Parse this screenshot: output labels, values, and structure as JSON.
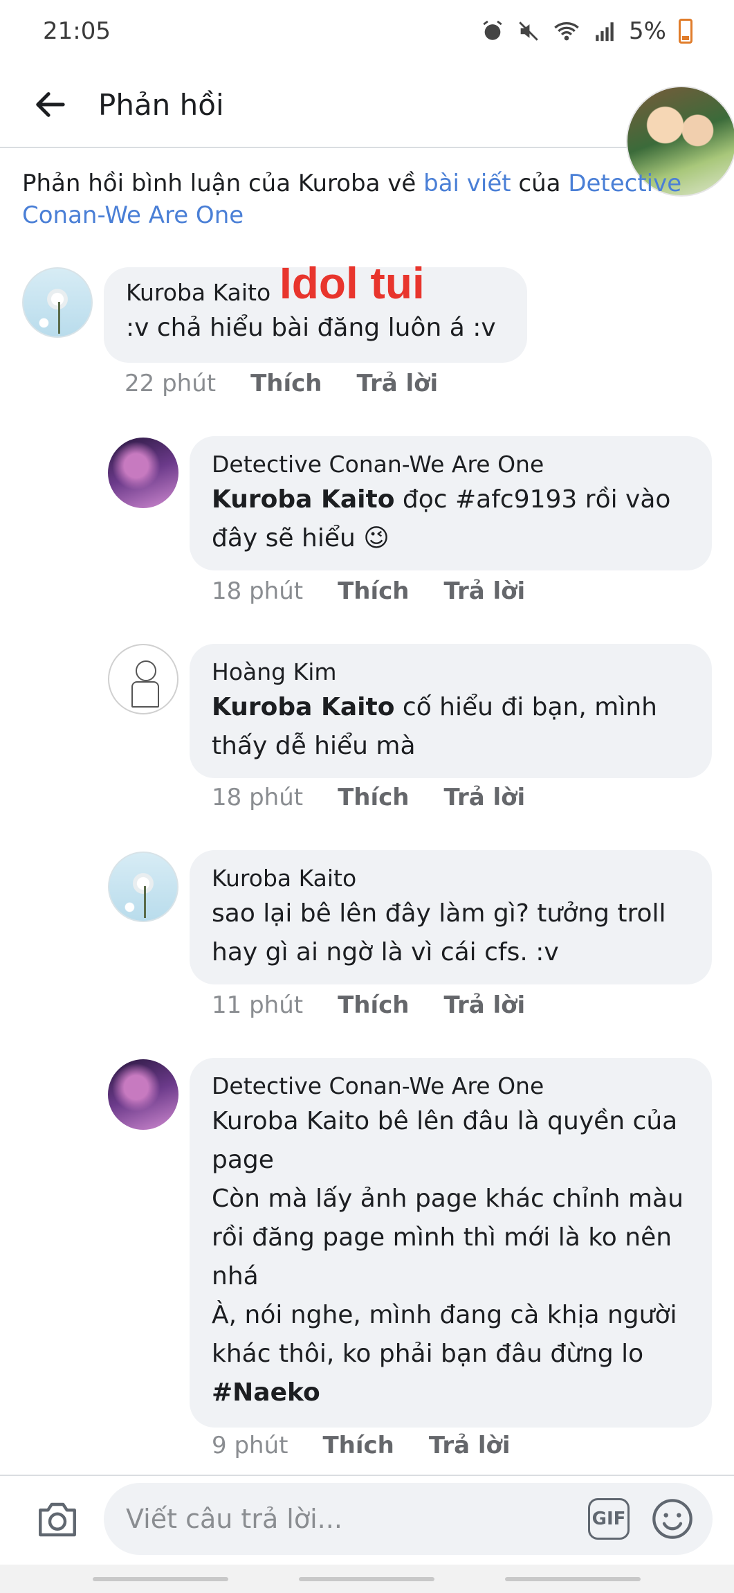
{
  "status_bar": {
    "time": "21:05",
    "battery": "5%",
    "icons": [
      "alarm-icon",
      "mute-icon",
      "wifi-icon",
      "signal-icon",
      "battery-icon"
    ]
  },
  "header": {
    "title": "Phản hồi",
    "back_icon": "back-arrow-icon"
  },
  "context": {
    "prefix": "Phản hồi bình luận của Kuroba về ",
    "post_link": "bài viết",
    "middle": " của ",
    "page_link": "Detective Conan-We Are One"
  },
  "overlay_text": "Idol tui",
  "comments": [
    {
      "author": "Kuroba Kaito",
      "text": ":v chả hiểu bài đăng luôn á :v",
      "time": "22 phút",
      "like": "Thích",
      "reply": "Trả lời"
    },
    {
      "author": "Detective Conan-We Are One",
      "tag": "Kuroba Kaito",
      "text": " đọc #afc9193 rồi vào đây sẽ hiểu 😉",
      "time": "18 phút",
      "like": "Thích",
      "reply": "Trả lời"
    },
    {
      "author": "Hoàng Kim",
      "tag": "Kuroba Kaito",
      "text": " cố hiểu đi bạn, mình thấy dễ hiểu mà",
      "time": "18 phút",
      "like": "Thích",
      "reply": "Trả lời"
    },
    {
      "author": "Kuroba Kaito",
      "text": "sao lại bê lên đây làm gì? tưởng troll hay gì ai ngờ là vì cái cfs. :v",
      "time": "11 phút",
      "like": "Thích",
      "reply": "Trả lời"
    },
    {
      "author": "Detective Conan-We Are One",
      "lines": [
        "Kuroba Kaito bê lên đâu là quyền của page",
        "Còn mà lấy ảnh page khác chỉnh màu rồi đăng page mình thì mới là ko nên nhá",
        "À, nói nghe, mình đang cà khịa người khác thôi, ko phải bạn đâu đừng lo"
      ],
      "signature": "#Naeko",
      "time": "9 phút",
      "like": "Thích",
      "reply": "Trả lời"
    }
  ],
  "composer": {
    "placeholder": "Viết câu trả lời...",
    "gif_label": "GIF",
    "camera_icon": "camera-icon",
    "emoji_icon": "emoji-icon"
  }
}
